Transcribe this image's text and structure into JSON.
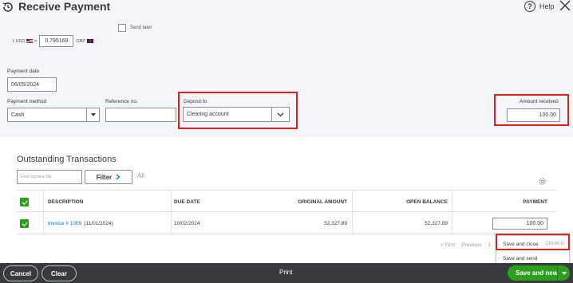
{
  "header": {
    "title": "Receive Payment",
    "help_label": "Help"
  },
  "send_later_label": "Send later",
  "exchange": {
    "base_label": "1 USD",
    "equals": "=",
    "rate": "0.795169",
    "quote_label": "GBP"
  },
  "payment_date": {
    "label": "Payment date",
    "value": "06/05/2024"
  },
  "payment_method": {
    "label": "Payment method",
    "value": "Cash"
  },
  "reference": {
    "label": "Reference no.",
    "value": ""
  },
  "deposit_to": {
    "label": "Deposit to",
    "value": "Clearing account"
  },
  "amount_received": {
    "label": "Amount received",
    "value": "100.00"
  },
  "outstanding": {
    "title": "Outstanding Transactions",
    "find_placeholder": "Find Invoice No.",
    "filter_label": "Filter",
    "all_label": "All",
    "columns": [
      "DESCRIPTION",
      "DUE DATE",
      "ORIGINAL AMOUNT",
      "OPEN BALANCE",
      "PAYMENT"
    ],
    "rows": [
      {
        "invoice_link": "Invoice # 1009",
        "invoice_date": "(11/01/2024)",
        "due_date": "10/02/2024",
        "original_amount": "52,327.89",
        "open_balance": "52,327.89",
        "payment": "100.00"
      }
    ]
  },
  "pagination": {
    "first": "< First",
    "previous": "Previous",
    "range": "1-"
  },
  "save_menu": {
    "items": [
      "Save and close",
      "Save and send"
    ],
    "shortcut": "Ctrl Alt D"
  },
  "footer": {
    "cancel": "Cancel",
    "clear": "Clear",
    "print": "Print",
    "save_new": "Save and new"
  },
  "colors": {
    "accent_green": "#2ca01c",
    "link_blue": "#0077c5",
    "highlight_red": "#e0201a",
    "footer_bg": "#393a3d"
  }
}
